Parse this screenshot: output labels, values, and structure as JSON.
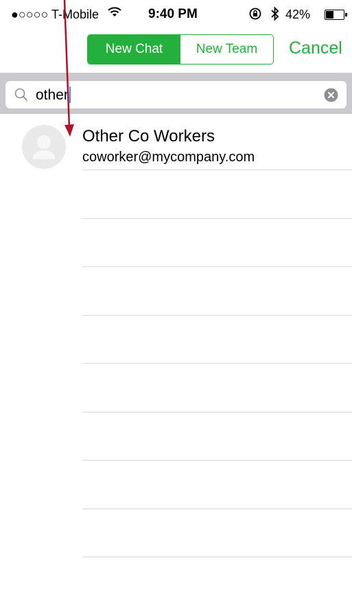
{
  "status_bar": {
    "carrier": "●○○○○ T-Mobile",
    "time": "9:40 PM",
    "battery_percent": "42%",
    "battery_level": 0.42,
    "icons": [
      "wifi-icon",
      "orientation-lock-icon",
      "bluetooth-icon",
      "battery-icon"
    ]
  },
  "nav": {
    "segments": [
      {
        "label": "New Chat",
        "selected": true
      },
      {
        "label": "New Team",
        "selected": false
      }
    ],
    "cancel_label": "Cancel"
  },
  "search": {
    "value": "other"
  },
  "results": [
    {
      "name": "Other Co Workers",
      "email": "coworker@mycompany.com"
    }
  ],
  "colors": {
    "accent": "#23b03d",
    "search_bar_bg": "#c9c9ce",
    "annotation_arrow": "#b0102a",
    "caret": "#4b8cf5"
  }
}
